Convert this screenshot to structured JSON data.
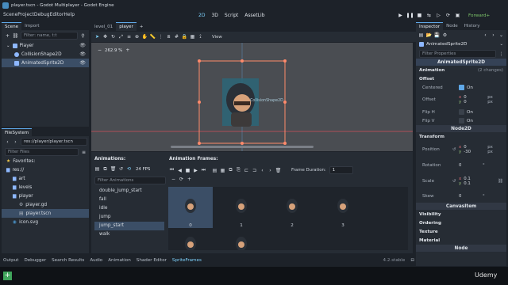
{
  "window": {
    "title": "player.tscn - Godot Multiplayer - Godot Engine"
  },
  "menu": [
    "Scene",
    "Project",
    "Debug",
    "Editor",
    "Help"
  ],
  "modes": [
    "2D",
    "3D",
    "Script",
    "AssetLib"
  ],
  "renderer": "Forward+",
  "scene_dock": {
    "tabs": [
      "Scene",
      "Import"
    ],
    "filter_placeholder": "Filter: name, t:t",
    "tree": [
      {
        "label": "Player",
        "color": "#8eb8ff"
      },
      {
        "label": "CollisionShape2D",
        "color": "#8eb8ff"
      },
      {
        "label": "AnimatedSprite2D",
        "color": "#8eb8ff"
      }
    ]
  },
  "filesystem": {
    "tab": "FileSystem",
    "path": "res://player/player.tscn",
    "filter_placeholder": "Filter Files",
    "favorites": "Favorites:",
    "items": [
      {
        "label": "res://"
      },
      {
        "label": "art"
      },
      {
        "label": "levels"
      },
      {
        "label": "player"
      },
      {
        "label": "player.gd"
      },
      {
        "label": "player.tscn"
      },
      {
        "label": "icon.svg"
      }
    ]
  },
  "editor_tabs": [
    "level_01",
    "player"
  ],
  "viewport": {
    "zoom": "262.9 %",
    "view_label": "View",
    "shape_label": "CollisionShape2D"
  },
  "animations": {
    "title": "Animations:",
    "fps": "24 FPS",
    "filter_placeholder": "Filter Animations",
    "list": [
      "double_jump_start",
      "fall",
      "idle",
      "jump",
      "jump_start",
      "walk"
    ],
    "selected": "jump_start"
  },
  "frames": {
    "title": "Animation Frames:",
    "duration_label": "Frame Duration:",
    "duration_value": "1",
    "labels": [
      "0",
      "1",
      "2",
      "3"
    ]
  },
  "inspector": {
    "tabs": [
      "Inspector",
      "Node",
      "History"
    ],
    "object": "AnimatedSprite2D",
    "filter_placeholder": "Filter Properties",
    "class_header": "AnimatedSprite2D",
    "animation_section": "Animation",
    "changes": "(2 changes)",
    "offset_section": "Offset",
    "centered_label": "Centered",
    "centered_value": "On",
    "offset_label": "Offset",
    "offset_x": "0",
    "offset_y": "0",
    "px": "px",
    "fliph_label": "Flip H",
    "fliph_value": "On",
    "flipv_label": "Flip V",
    "flipv_value": "On",
    "node2d_header": "Node2D",
    "transform_section": "Transform",
    "position_label": "Position",
    "position_x": "0",
    "position_y": "-30",
    "rotation_label": "Rotation",
    "rotation_value": "0",
    "rotation_unit": "°",
    "scale_label": "Scale",
    "scale_x": "0.1",
    "scale_y": "0.1",
    "skew_label": "Skew",
    "skew_value": "0",
    "canvasitem_header": "CanvasItem",
    "sections": [
      "Visibility",
      "Ordering",
      "Texture",
      "Material"
    ],
    "node_header": "Node"
  },
  "bottom_tabs": [
    "Output",
    "Debugger",
    "Search Results",
    "Audio",
    "Animation",
    "Shader Editor",
    "SpriteFrames"
  ],
  "version": "4.2.stable",
  "watermark": "Udemy",
  "colors": {
    "accent": "#5fa8e8",
    "selection": "#3b4e66",
    "handle": "#ff8a6b"
  }
}
